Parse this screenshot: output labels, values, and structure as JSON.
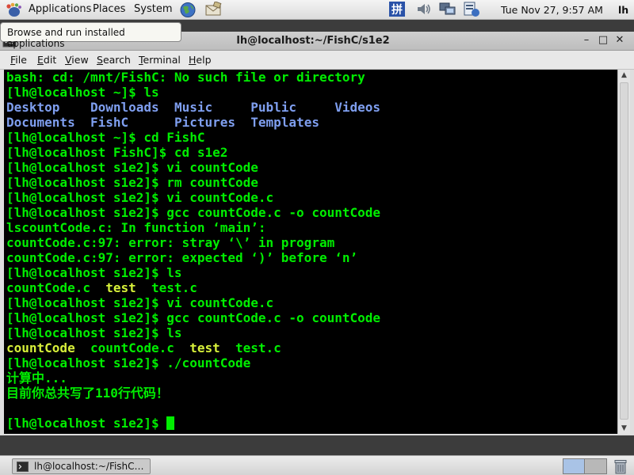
{
  "top_panel": {
    "menus": {
      "applications": "Applications",
      "places": "Places",
      "system": "System"
    },
    "clock": "Tue Nov 27,  9:57 AM",
    "user": "lh"
  },
  "tooltip": "Browse and run installed applications",
  "window": {
    "title": "lh@localhost:~/FishC/s1e2",
    "controls": {
      "minimize": "–",
      "maximize": "□",
      "close": "✕"
    }
  },
  "menubar": {
    "file": {
      "key": "F",
      "rest": "ile"
    },
    "edit": {
      "key": "E",
      "rest": "dit"
    },
    "view": {
      "key": "V",
      "rest": "iew"
    },
    "search": {
      "key": "S",
      "rest": "earch"
    },
    "terminal": {
      "key": "T",
      "rest": "erminal"
    },
    "help": {
      "key": "H",
      "rest": "elp"
    }
  },
  "terminal": {
    "lines": [
      [
        {
          "t": "bash: cd: /mnt/FishC: No such file or directory",
          "c": "n"
        }
      ],
      [
        {
          "t": "[lh@localhost ~]$ ls",
          "c": "n"
        }
      ],
      [
        {
          "t": "Desktop    ",
          "c": "dir"
        },
        {
          "t": "Downloads  ",
          "c": "dir"
        },
        {
          "t": "Music     ",
          "c": "dir"
        },
        {
          "t": "Public     ",
          "c": "dir"
        },
        {
          "t": "Videos",
          "c": "dir"
        }
      ],
      [
        {
          "t": "Documents  ",
          "c": "dir"
        },
        {
          "t": "FishC      ",
          "c": "dir"
        },
        {
          "t": "Pictures  ",
          "c": "dir"
        },
        {
          "t": "Templates",
          "c": "dir"
        }
      ],
      [
        {
          "t": "[lh@localhost ~]$ cd FishC",
          "c": "n"
        }
      ],
      [
        {
          "t": "[lh@localhost FishC]$ cd s1e2",
          "c": "n"
        }
      ],
      [
        {
          "t": "[lh@localhost s1e2]$ vi countCode",
          "c": "n"
        }
      ],
      [
        {
          "t": "[lh@localhost s1e2]$ rm countCode",
          "c": "n"
        }
      ],
      [
        {
          "t": "[lh@localhost s1e2]$ vi countCode.c",
          "c": "n"
        }
      ],
      [
        {
          "t": "[lh@localhost s1e2]$ gcc countCode.c -o countCode",
          "c": "n"
        }
      ],
      [
        {
          "t": "lscountCode.c: In function ‘main’:",
          "c": "n"
        }
      ],
      [
        {
          "t": "countCode.c:97: error: stray ‘\\’ in program",
          "c": "n"
        }
      ],
      [
        {
          "t": "countCode.c:97: error: expected ‘)’ before ‘n’",
          "c": "n"
        }
      ],
      [
        {
          "t": "[lh@localhost s1e2]$ ls",
          "c": "n"
        }
      ],
      [
        {
          "t": "countCode.c  ",
          "c": "n"
        },
        {
          "t": "test",
          "c": "exe"
        },
        {
          "t": "  test.c",
          "c": "n"
        }
      ],
      [
        {
          "t": "[lh@localhost s1e2]$ vi countCode.c",
          "c": "n"
        }
      ],
      [
        {
          "t": "[lh@localhost s1e2]$ gcc countCode.c -o countCode",
          "c": "n"
        }
      ],
      [
        {
          "t": "[lh@localhost s1e2]$ ls",
          "c": "n"
        }
      ],
      [
        {
          "t": "countCode",
          "c": "exe"
        },
        {
          "t": "  countCode.c  ",
          "c": "n"
        },
        {
          "t": "test",
          "c": "exe"
        },
        {
          "t": "  test.c",
          "c": "n"
        }
      ],
      [
        {
          "t": "[lh@localhost s1e2]$ ./countCode",
          "c": "n"
        }
      ],
      [
        {
          "t": "计算中...",
          "c": "n"
        }
      ],
      [
        {
          "t": "目前你总共写了110行代码！",
          "c": "n"
        }
      ],
      [
        {
          "t": "",
          "c": "n"
        }
      ],
      [
        {
          "t": "[lh@localhost s1e2]$ ",
          "c": "n"
        }
      ]
    ],
    "colors": {
      "text": "#00ee00",
      "directory": "#7f9ff0",
      "executable": "#d7f03a",
      "background": "#000000"
    }
  },
  "taskbar": {
    "task_label": "lh@localhost:~/FishC…"
  },
  "icons": {
    "logo": "gnome-foot-icon",
    "launchers": [
      "web-browser-icon",
      "mail-client-icon"
    ],
    "tray": [
      "input-method-icon",
      "volume-icon",
      "network-icon",
      "update-notifier-icon"
    ]
  }
}
